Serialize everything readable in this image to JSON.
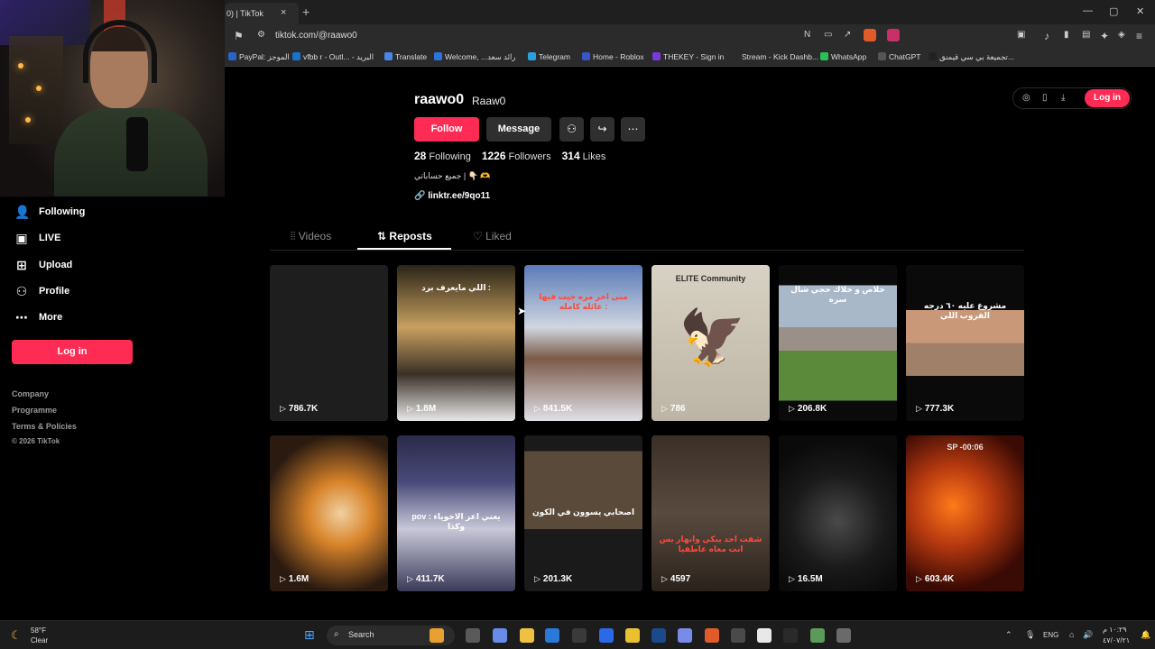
{
  "browser": {
    "tab_title": "0) | TikTok",
    "tab_close": "×",
    "new_tab": "+",
    "url": "tiktok.com/@raawo0",
    "window_minimize": "—",
    "window_restore": "▢",
    "window_close": "✕",
    "bookmarks": [
      {
        "label": "PayPal: الموجز",
        "color": "#2a63c9"
      },
      {
        "label": "vfbb r - Outl... - البريد",
        "color": "#1a73c8"
      },
      {
        "label": "Translate",
        "color": "#4a85e8"
      },
      {
        "label": "Welcome, ...رائد سعد",
        "color": "#2b74d8"
      },
      {
        "label": "Telegram",
        "color": "#2aa2e0"
      },
      {
        "label": "Home - Roblox",
        "color": "#3a55c8"
      },
      {
        "label": "THEKEY - Sign in",
        "color": "#7a3ad8"
      },
      {
        "label": "Stream - Kick Dashb...",
        "color": "#2a2a2a"
      },
      {
        "label": "WhatsApp",
        "color": "#2bbf55"
      },
      {
        "label": "ChatGPT",
        "color": "#555555"
      },
      {
        "label": "تجميعة بي سي قيمنق...",
        "color": "#222222"
      }
    ]
  },
  "sidebar": {
    "items": [
      {
        "label": "Following",
        "icon": "following-icon"
      },
      {
        "label": "LIVE",
        "icon": "live-icon"
      },
      {
        "label": "Upload",
        "icon": "upload-icon"
      },
      {
        "label": "Profile",
        "icon": "profile-icon"
      },
      {
        "label": "More",
        "icon": "more-icon"
      }
    ],
    "login_label": "Log in",
    "footer": {
      "company": "Company",
      "programme": "Programme",
      "terms": "Terms & Policies",
      "copyright": "© 2026 TikTok"
    }
  },
  "profile": {
    "username": "raawo0",
    "nickname": "Raaw0",
    "follow_label": "Follow",
    "message_label": "Message",
    "following_count": "28",
    "following_label": "Following",
    "followers_count": "1226",
    "followers_label": "Followers",
    "likes_count": "314",
    "likes_label": "Likes",
    "bio": "جميع حساباتي | 👇🏻 🫶",
    "link": "linktr.ee/9qo11"
  },
  "header": {
    "login_label": "Log in"
  },
  "tabs": [
    {
      "label": "Videos",
      "icon": "grid-icon",
      "active": false
    },
    {
      "label": "Reposts",
      "icon": "repost-icon",
      "active": true
    },
    {
      "label": "Liked",
      "icon": "liked-icon",
      "active": false
    }
  ],
  "videos": [
    {
      "views": "786.7K",
      "caption": ""
    },
    {
      "views": "1.8M",
      "caption": "اللي مايعرف برد :"
    },
    {
      "views": "841.5K",
      "caption": "متى اخر مره جيت فيها عائله كامله :"
    },
    {
      "views": "786",
      "caption": "ELITE Community"
    },
    {
      "views": "206.8K",
      "caption": "خلاص و خلاك حجي شال سره"
    },
    {
      "views": "777.3K",
      "caption": "مشروع عليه ٦٠ درجه القروب اللي"
    },
    {
      "views": "1.6M",
      "caption": ""
    },
    {
      "views": "411.7K",
      "caption": "pov : يعني اعز الاخوياء وكذا"
    },
    {
      "views": "201.3K",
      "caption": "اصحابي يسوون في الكون"
    },
    {
      "views": "4597",
      "caption": "شفت احد يبكي وانهار بس انت معاه عاطفيا"
    },
    {
      "views": "16.5M",
      "caption": ""
    },
    {
      "views": "603.4K",
      "caption": "SP -00:06"
    }
  ],
  "taskbar": {
    "temp": "58°F",
    "condition": "Clear",
    "search_label": "Search",
    "lang": "ENG",
    "time": "١٠:٢٩ م",
    "date": "٤٧/٠٧/٢١"
  }
}
